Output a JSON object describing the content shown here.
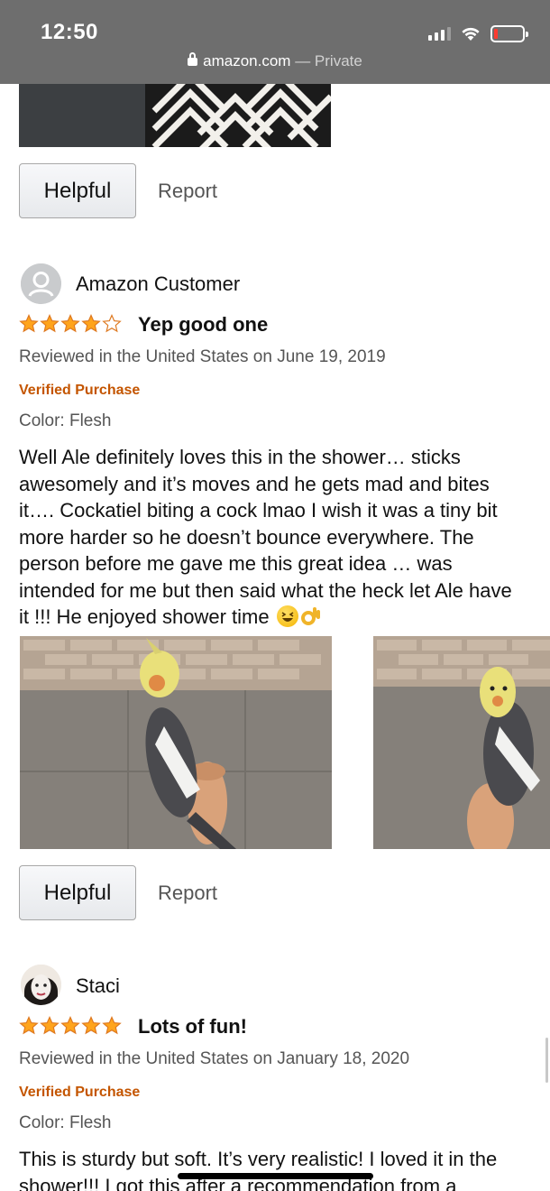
{
  "status_bar": {
    "time": "12:50"
  },
  "browser": {
    "domain": "amazon.com",
    "separator": " — ",
    "mode": "Private"
  },
  "reviews": [
    {
      "actions": {
        "helpful": "Helpful",
        "report": "Report"
      }
    },
    {
      "reviewer": "Amazon Customer",
      "rating": 4,
      "rating_max": 5,
      "title": "Yep good one",
      "date": "Reviewed in the United States on June 19, 2019",
      "verified": "Verified Purchase",
      "color": "Color: Flesh",
      "body": "Well Ale definitely loves this in the shower… sticks awesomely and it’s moves and he gets mad and bites it…. Cockatiel biting a cock lmao I wish it was a tiny bit more harder so he doesn’t bounce everywhere. The person before me gave me this great idea … was intended for me but then said what the heck let Ale have it !!! He enjoyed shower time",
      "emoji_icons": [
        "laughing-face-icon",
        "ok-hand-icon"
      ],
      "actions": {
        "helpful": "Helpful",
        "report": "Report"
      }
    },
    {
      "reviewer": "Staci",
      "rating": 5,
      "rating_max": 5,
      "title": "Lots of fun!",
      "date": "Reviewed in the United States on January 18, 2020",
      "verified": "Verified Purchase",
      "color": "Color: Flesh",
      "body": "This is sturdy but soft. It’s very realistic! I loved it in the shower!!! I got this after a recommendation from a"
    }
  ],
  "colors": {
    "star": "#ffa41c",
    "verified": "#c45500",
    "status_bar": "#6e6e6e",
    "battery_low": "#ff3b30"
  }
}
